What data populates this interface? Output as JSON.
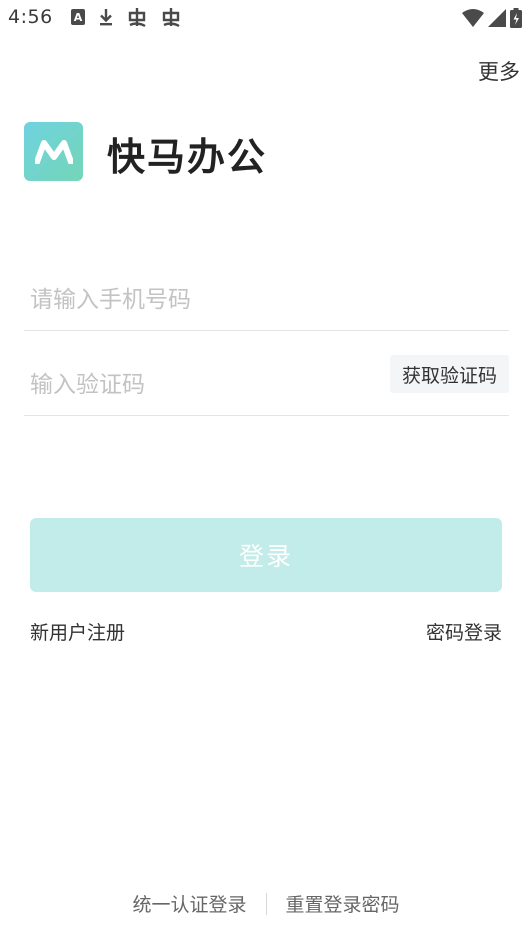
{
  "status_bar": {
    "time": "4:56",
    "icons_left": [
      "a-box-icon",
      "download-icon",
      "bug-icon",
      "bug-icon"
    ],
    "icons_right": [
      "wifi-icon",
      "signal-icon",
      "battery-icon"
    ]
  },
  "header": {
    "more_label": "更多",
    "app_title": "快马办公",
    "logo_icon": "m-logo-icon",
    "logo_colors": [
      "#6fd2e0",
      "#74d6b6"
    ]
  },
  "form": {
    "phone_placeholder": "请输入手机号码",
    "phone_value": "",
    "code_placeholder": "输入验证码",
    "code_value": "",
    "get_code_label": "获取验证码",
    "login_label": "登录",
    "login_color": "#c2ecea"
  },
  "links": {
    "register": "新用户注册",
    "password_login": "密码登录"
  },
  "footer": {
    "sso_login": "统一认证登录",
    "reset_password": "重置登录密码"
  }
}
